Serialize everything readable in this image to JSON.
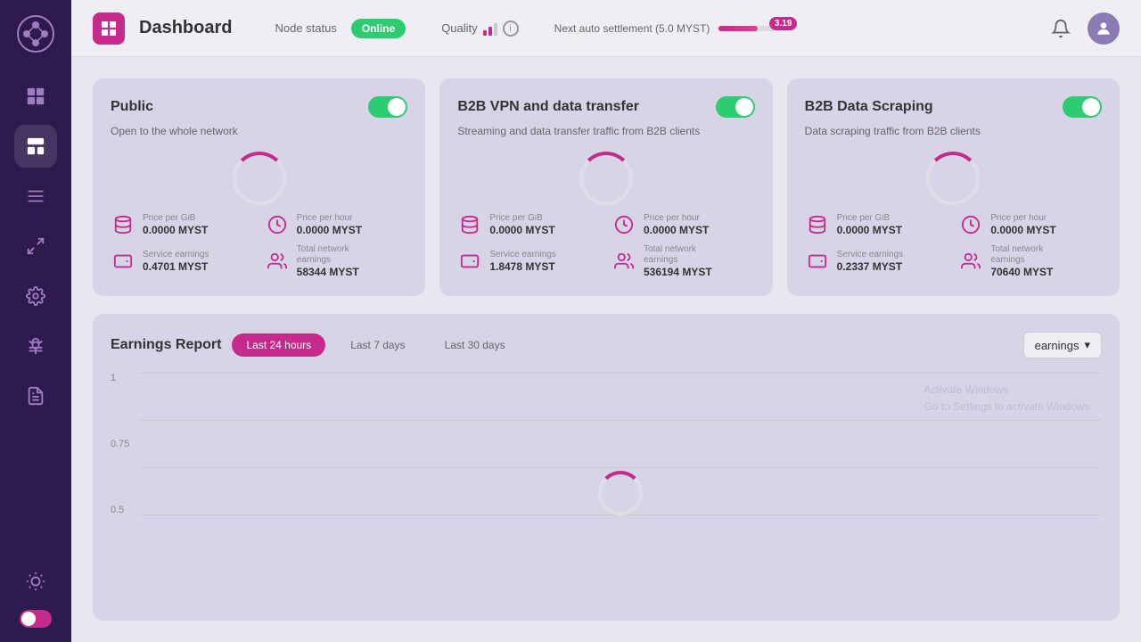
{
  "sidebar": {
    "items": [
      {
        "id": "grid",
        "label": "Grid"
      },
      {
        "id": "layout",
        "label": "Layout",
        "active": true
      },
      {
        "id": "list",
        "label": "List"
      },
      {
        "id": "network",
        "label": "Network"
      },
      {
        "id": "settings",
        "label": "Settings"
      },
      {
        "id": "bug",
        "label": "Bug"
      },
      {
        "id": "reports",
        "label": "Reports"
      }
    ],
    "dark_mode_label": "Dark mode"
  },
  "header": {
    "logo_icon": "☰",
    "title": "Dashboard",
    "node_status_label": "Node status",
    "status_online": "Online",
    "quality_label": "Quality",
    "settlement_label": "Next auto settlement (5.0 MYST)",
    "settlement_badge": "3.19"
  },
  "cards": [
    {
      "id": "public",
      "title": "Public",
      "subtitle": "Open to the whole network",
      "toggle_on": true,
      "price_per_gib_label": "Price per GiB",
      "price_per_gib": "0.0000 MYST",
      "price_per_hour_label": "Price per hour",
      "price_per_hour": "0.0000 MYST",
      "service_earnings_label": "Service earnings",
      "service_earnings": "0.4701 MYST",
      "total_network_earnings_label": "Total network earnings",
      "total_network_earnings": "58344 MYST"
    },
    {
      "id": "b2b-vpn",
      "title": "B2B VPN and data transfer",
      "subtitle": "Streaming and data transfer traffic from B2B clients",
      "toggle_on": true,
      "price_per_gib_label": "Price per GiB",
      "price_per_gib": "0.0000 MYST",
      "price_per_hour_label": "Price per hour",
      "price_per_hour": "0.0000 MYST",
      "service_earnings_label": "Service earnings",
      "service_earnings": "1.8478 MYST",
      "total_network_earnings_label": "Total network earnings",
      "total_network_earnings": "536194 MYST"
    },
    {
      "id": "b2b-scraping",
      "title": "B2B Data Scraping",
      "subtitle": "Data scraping traffic from B2B clients",
      "toggle_on": true,
      "price_per_gib_label": "Price per GiB",
      "price_per_gib": "0.0000 MYST",
      "price_per_hour_label": "Price per hour",
      "price_per_hour": "0.0000 MYST",
      "service_earnings_label": "Service earnings",
      "service_earnings": "0.2337 MYST",
      "total_network_earnings_label": "Total network earnings",
      "total_network_earnings": "70640 MYST"
    }
  ],
  "earnings_report": {
    "title": "Earnings Report",
    "tabs": [
      {
        "id": "24h",
        "label": "Last 24 hours",
        "active": true
      },
      {
        "id": "7d",
        "label": "Last 7 days",
        "active": false
      },
      {
        "id": "30d",
        "label": "Last 30 days",
        "active": false
      }
    ],
    "dropdown_label": "earnings",
    "chart_y_labels": [
      "1",
      "0.75",
      "0.5"
    ],
    "watermark": "Activate Windows\nGo to Settings to activate Windows."
  }
}
